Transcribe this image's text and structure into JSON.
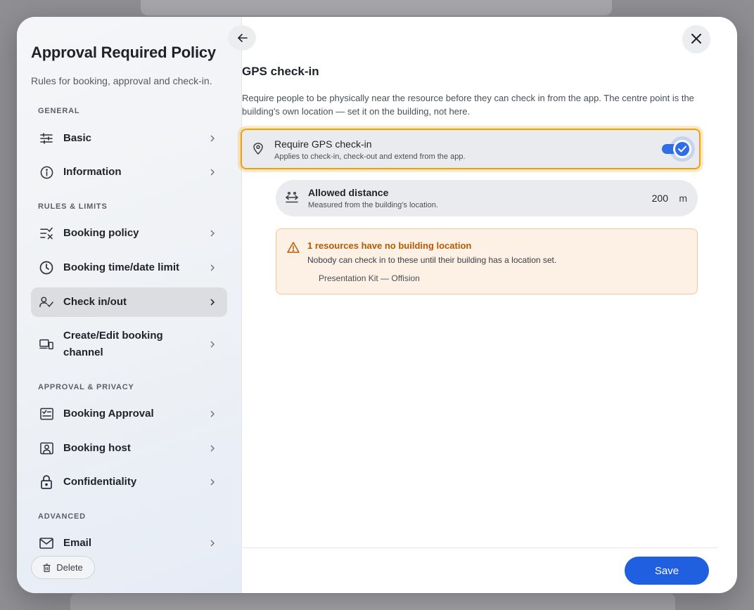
{
  "sidebar": {
    "title": "Approval Required Policy",
    "subtitle": "Rules for booking, approval and check-in.",
    "sections": {
      "general": "GENERAL",
      "rules": "RULES & LIMITS",
      "approval": "APPROVAL & PRIVACY",
      "advanced": "ADVANCED"
    },
    "items": [
      {
        "label": "Basic",
        "icon": "sliders-icon"
      },
      {
        "label": "Information",
        "icon": "info-icon"
      },
      {
        "label": "Booking policy",
        "icon": "list-check-icon"
      },
      {
        "label": "Booking time/date limit",
        "icon": "clock-icon"
      },
      {
        "label": "Check in/out",
        "icon": "user-check-icon",
        "active": true
      },
      {
        "label": "Create/Edit booking channel",
        "icon": "devices-icon"
      },
      {
        "label": "Booking Approval",
        "icon": "approval-form-icon"
      },
      {
        "label": "Booking host",
        "icon": "host-badge-icon"
      },
      {
        "label": "Confidentiality",
        "icon": "lock-icon"
      },
      {
        "label": "Email",
        "icon": "mail-icon"
      }
    ],
    "delete_label": "Delete"
  },
  "main": {
    "title": "GPS check-in",
    "description": "Require people to be physically near the resource before they can check in from the app. The centre point is the building's own location — set it on the building, not here.",
    "gps": {
      "title": "Require GPS check-in",
      "subtitle": "Applies to check-in, check-out and extend from the app.",
      "enabled": true
    },
    "distance": {
      "title": "Allowed distance",
      "subtitle": "Measured from the building's location.",
      "value": "200",
      "unit": "m"
    },
    "warning": {
      "title": "1 resources have no building location",
      "body": "Nobody can check in to these until their building has a location set.",
      "items": [
        "Presentation Kit — Offision"
      ]
    },
    "save_label": "Save"
  },
  "colors": {
    "accent": "#1f5fe0",
    "highlight": "#f0a000",
    "warning_text": "#b95800",
    "warning_bg": "#fdf0e4"
  }
}
